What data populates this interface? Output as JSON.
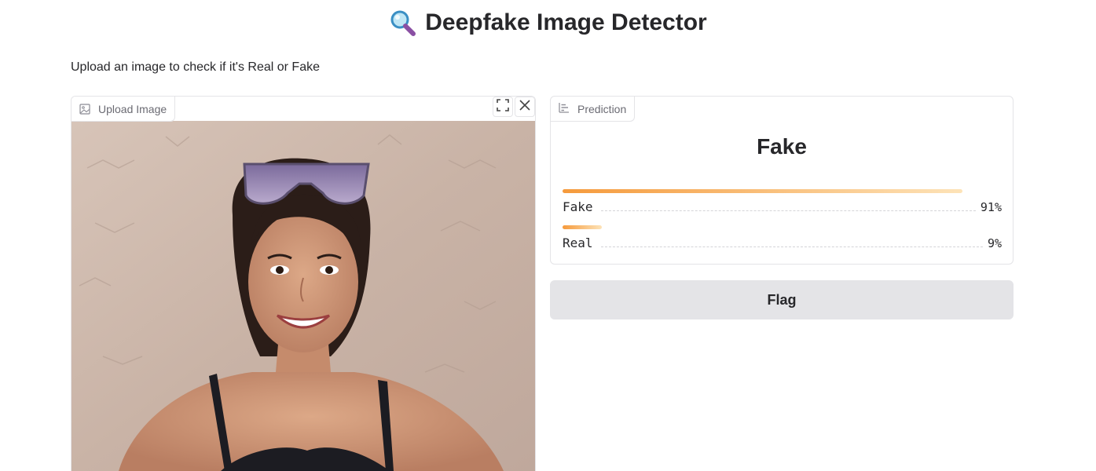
{
  "header": {
    "title": "Deepfake Image Detector",
    "icon": "magnifier-icon",
    "description": "Upload an image to check if it's Real or Fake"
  },
  "upload": {
    "label": "Upload Image",
    "label_icon": "image-icon",
    "tools": [
      "fullscreen-icon",
      "close-icon"
    ]
  },
  "prediction": {
    "label": "Prediction",
    "label_icon": "bar-chart-icon",
    "top_label": "Fake",
    "confidences": [
      {
        "label": "Fake",
        "percent_text": "91%",
        "value": 0.91
      },
      {
        "label": "Real",
        "percent_text": "9%",
        "value": 0.09
      }
    ]
  },
  "actions": {
    "flag_label": "Flag"
  },
  "colors": {
    "accent": "#f59a3c",
    "accent_light": "#fde3b8",
    "button_bg": "#e4e4e7",
    "border": "#e4e4e7"
  }
}
